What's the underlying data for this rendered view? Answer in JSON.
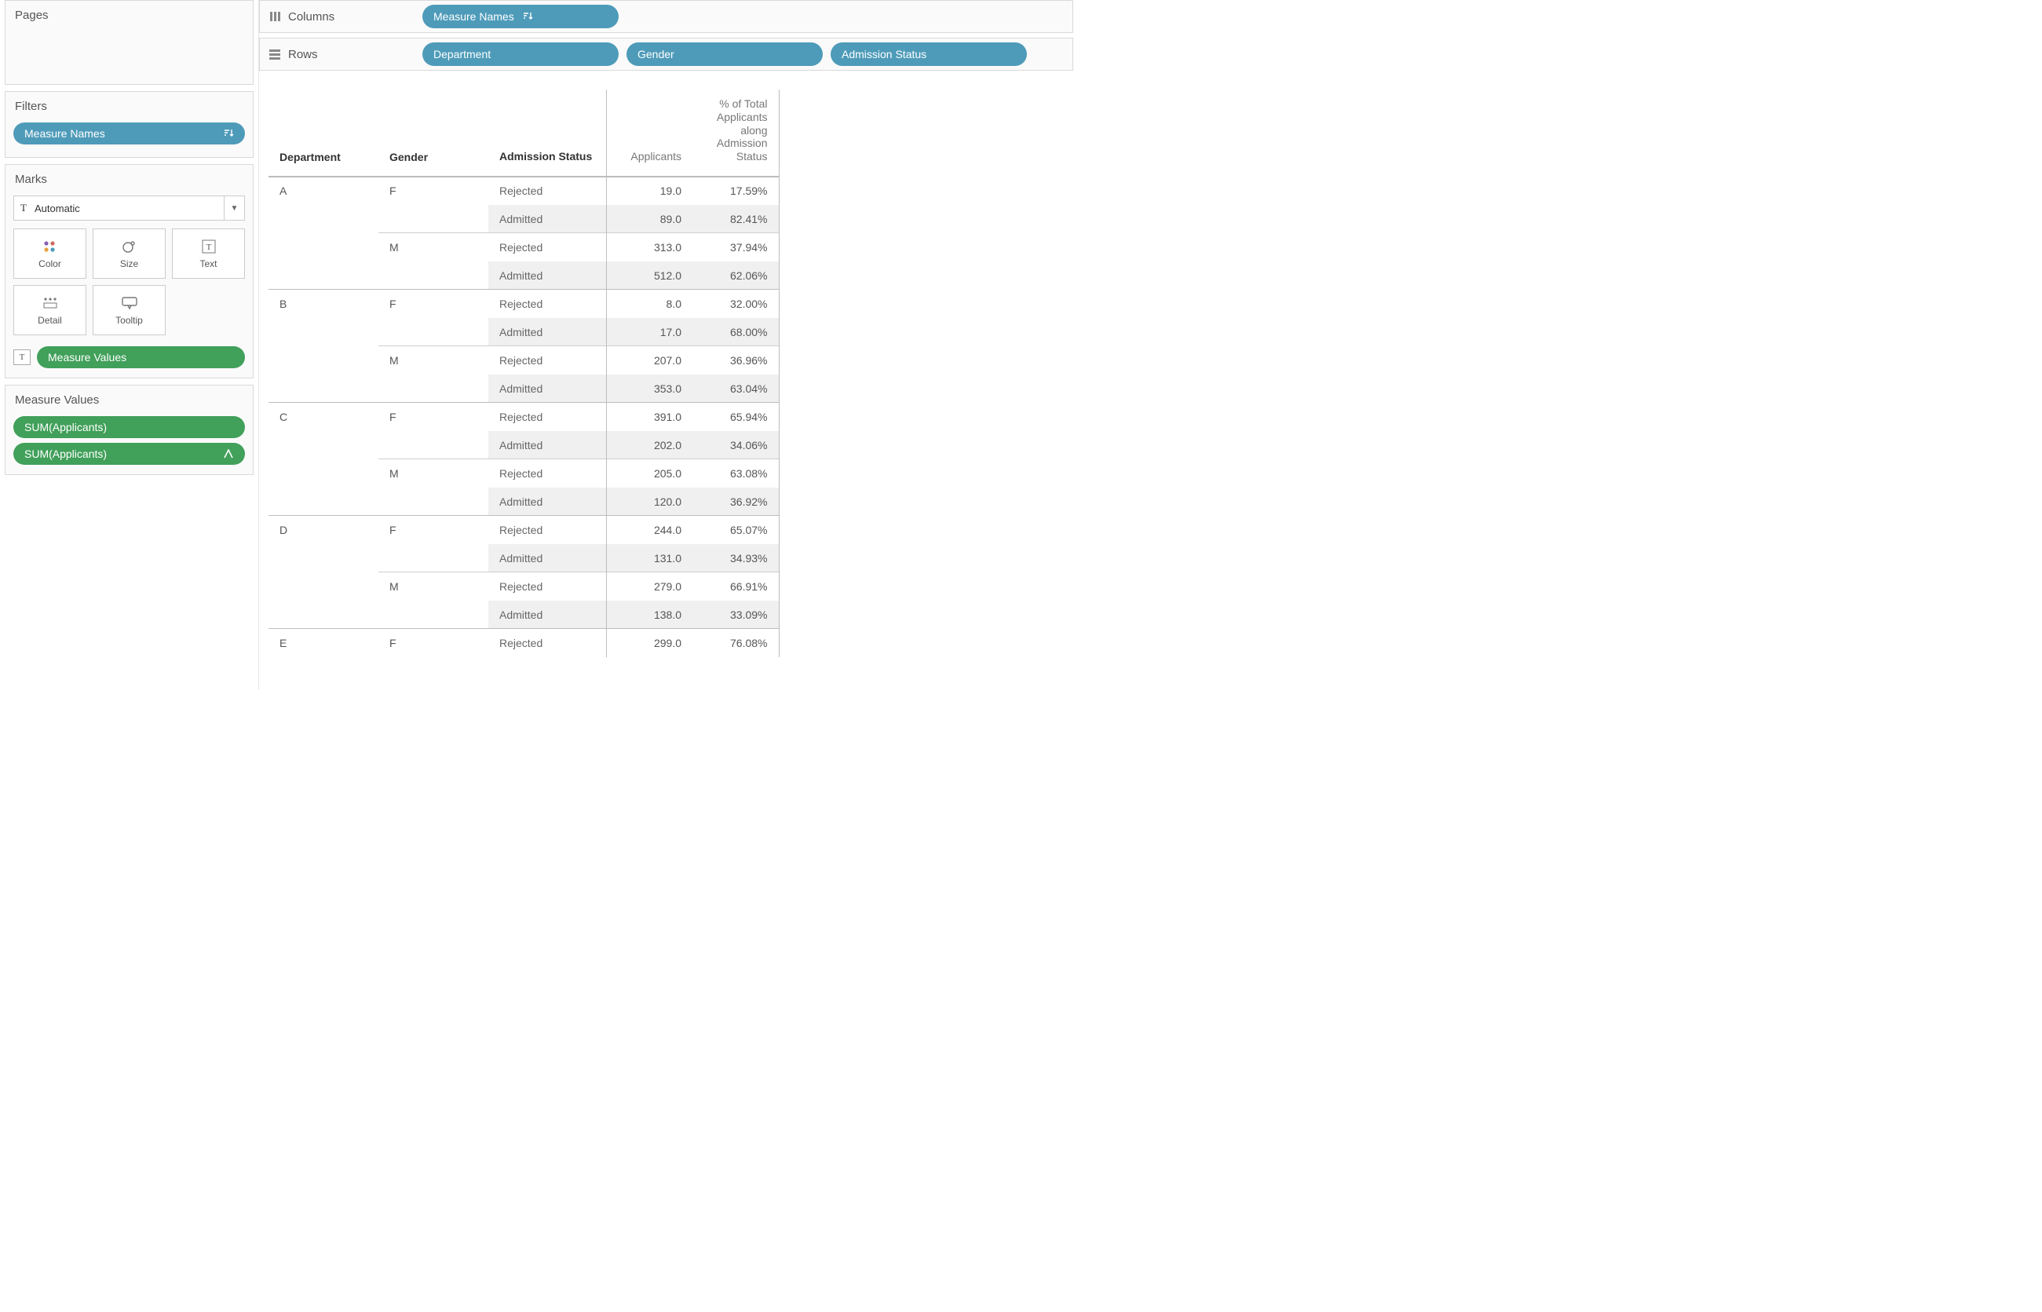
{
  "left": {
    "pages_title": "Pages",
    "filters_title": "Filters",
    "filters_pill": "Measure Names",
    "marks": {
      "title": "Marks",
      "type_label": "Automatic",
      "buttons": [
        "Color",
        "Size",
        "Text",
        "Detail",
        "Tooltip"
      ],
      "text_chip": "Measure Values"
    },
    "measure_values": {
      "title": "Measure Values",
      "pills": [
        "SUM(Applicants)",
        "SUM(Applicants)"
      ]
    }
  },
  "shelves": {
    "columns_label": "Columns",
    "rows_label": "Rows",
    "columns_pills": [
      "Measure Names"
    ],
    "rows_pills": [
      "Department",
      "Gender",
      "Admission Status"
    ]
  },
  "crosstab": {
    "headers": {
      "dept": "Department",
      "gender": "Gender",
      "status": "Admission Status",
      "meas1": "Applicants",
      "meas2": "% of Total Applicants along Admission Status"
    },
    "rows": [
      {
        "dept": "A",
        "gender": "F",
        "status": "Rejected",
        "applicants": "19.0",
        "pct": "17.59%",
        "sep": "dept"
      },
      {
        "dept": "",
        "gender": "",
        "status": "Admitted",
        "applicants": "89.0",
        "pct": "82.41%",
        "shade": true
      },
      {
        "dept": "",
        "gender": "M",
        "status": "Rejected",
        "applicants": "313.0",
        "pct": "37.94%",
        "sep": "gender"
      },
      {
        "dept": "",
        "gender": "",
        "status": "Admitted",
        "applicants": "512.0",
        "pct": "62.06%",
        "shade": true
      },
      {
        "dept": "B",
        "gender": "F",
        "status": "Rejected",
        "applicants": "8.0",
        "pct": "32.00%",
        "sep": "dept"
      },
      {
        "dept": "",
        "gender": "",
        "status": "Admitted",
        "applicants": "17.0",
        "pct": "68.00%",
        "shade": true
      },
      {
        "dept": "",
        "gender": "M",
        "status": "Rejected",
        "applicants": "207.0",
        "pct": "36.96%",
        "sep": "gender"
      },
      {
        "dept": "",
        "gender": "",
        "status": "Admitted",
        "applicants": "353.0",
        "pct": "63.04%",
        "shade": true
      },
      {
        "dept": "C",
        "gender": "F",
        "status": "Rejected",
        "applicants": "391.0",
        "pct": "65.94%",
        "sep": "dept"
      },
      {
        "dept": "",
        "gender": "",
        "status": "Admitted",
        "applicants": "202.0",
        "pct": "34.06%",
        "shade": true
      },
      {
        "dept": "",
        "gender": "M",
        "status": "Rejected",
        "applicants": "205.0",
        "pct": "63.08%",
        "sep": "gender"
      },
      {
        "dept": "",
        "gender": "",
        "status": "Admitted",
        "applicants": "120.0",
        "pct": "36.92%",
        "shade": true
      },
      {
        "dept": "D",
        "gender": "F",
        "status": "Rejected",
        "applicants": "244.0",
        "pct": "65.07%",
        "sep": "dept"
      },
      {
        "dept": "",
        "gender": "",
        "status": "Admitted",
        "applicants": "131.0",
        "pct": "34.93%",
        "shade": true
      },
      {
        "dept": "",
        "gender": "M",
        "status": "Rejected",
        "applicants": "279.0",
        "pct": "66.91%",
        "sep": "gender"
      },
      {
        "dept": "",
        "gender": "",
        "status": "Admitted",
        "applicants": "138.0",
        "pct": "33.09%",
        "shade": true
      },
      {
        "dept": "E",
        "gender": "F",
        "status": "Rejected",
        "applicants": "299.0",
        "pct": "76.08%",
        "sep": "dept"
      }
    ]
  },
  "chart_data": {
    "type": "table",
    "title": "",
    "columns": [
      "Department",
      "Gender",
      "Admission Status",
      "Applicants",
      "% of Total Applicants along Admission Status"
    ],
    "rows": [
      [
        "A",
        "F",
        "Rejected",
        19.0,
        17.59
      ],
      [
        "A",
        "F",
        "Admitted",
        89.0,
        82.41
      ],
      [
        "A",
        "M",
        "Rejected",
        313.0,
        37.94
      ],
      [
        "A",
        "M",
        "Admitted",
        512.0,
        62.06
      ],
      [
        "B",
        "F",
        "Rejected",
        8.0,
        32.0
      ],
      [
        "B",
        "F",
        "Admitted",
        17.0,
        68.0
      ],
      [
        "B",
        "M",
        "Rejected",
        207.0,
        36.96
      ],
      [
        "B",
        "M",
        "Admitted",
        353.0,
        63.04
      ],
      [
        "C",
        "F",
        "Rejected",
        391.0,
        65.94
      ],
      [
        "C",
        "F",
        "Admitted",
        202.0,
        34.06
      ],
      [
        "C",
        "M",
        "Rejected",
        205.0,
        63.08
      ],
      [
        "C",
        "M",
        "Admitted",
        120.0,
        36.92
      ],
      [
        "D",
        "F",
        "Rejected",
        244.0,
        65.07
      ],
      [
        "D",
        "F",
        "Admitted",
        131.0,
        34.93
      ],
      [
        "D",
        "M",
        "Rejected",
        279.0,
        66.91
      ],
      [
        "D",
        "M",
        "Admitted",
        138.0,
        33.09
      ],
      [
        "E",
        "F",
        "Rejected",
        299.0,
        76.08
      ]
    ]
  }
}
